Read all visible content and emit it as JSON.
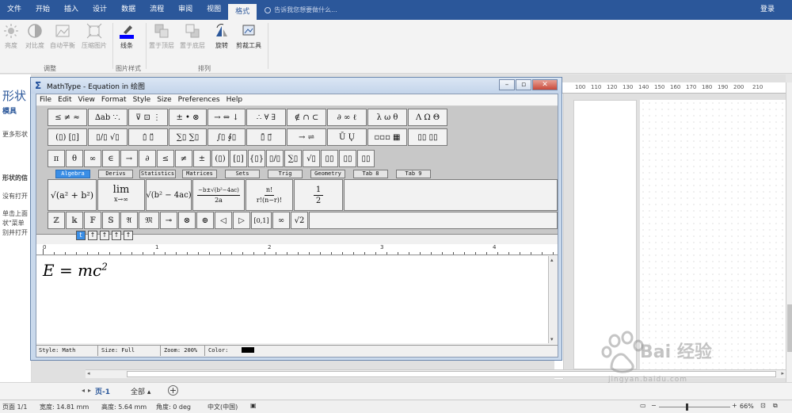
{
  "ribbon": {
    "tabs": [
      "文件",
      "开始",
      "插入",
      "设计",
      "数据",
      "流程",
      "审阅",
      "视图",
      "格式"
    ],
    "active_tab": "格式",
    "tell_me": "告诉我您想要做什么...",
    "login": "登录",
    "buttons": {
      "brightness": "亮度",
      "contrast": "对比度",
      "auto_balance": "自动平衡",
      "compress": "压缩图片",
      "line": "线条",
      "bring_forward": "置于顶层",
      "send_backward": "置于底层",
      "rotate": "旋转",
      "crop": "剪裁工具"
    },
    "groups": {
      "adjust": "调整",
      "picture_style": "图片样式",
      "arrange": "排列"
    }
  },
  "left_pane": {
    "title": "形状",
    "tab": "模具",
    "more": "更多形状",
    "section": "形状的信",
    "text1": "没有打开",
    "text2": "单击上面",
    "text3": "状\"菜单",
    "text4": "别并打开"
  },
  "ruler": {
    "labels": [
      "100",
      "110",
      "120",
      "130",
      "140",
      "150",
      "160",
      "170",
      "180",
      "190",
      "200",
      "210"
    ]
  },
  "mathtype": {
    "title": "MathType - Equation in 绘图",
    "menu": [
      "File",
      "Edit",
      "View",
      "Format",
      "Style",
      "Size",
      "Preferences",
      "Help"
    ],
    "palette_row1": [
      "≤ ≠ ≈",
      "∆ab ∵.",
      "⊽ ⊡ ⋮",
      "± • ⊗",
      "→ ⇔ ↓",
      "∴ ∀ ∃",
      "∉ ∩ ⊂",
      "∂ ∞ ℓ",
      "λ ω θ",
      "Λ Ω Θ"
    ],
    "palette_row2": [
      "(▯) [▯]",
      "▯/▯ √▯",
      "▯̇ ▯̈",
      "∑▯ ∑▯",
      "∫▯ ∮▯",
      "▯̄ ▯⃗",
      "→ ⇌",
      "Ū Ų",
      "▫▫▫ ▦",
      "▯▯ ▯▯"
    ],
    "symbol_row": [
      "π",
      "θ",
      "∞",
      "∈",
      "→",
      "∂",
      "≤",
      "≠",
      "±",
      "(▯)",
      "[▯]",
      "{▯}",
      "▯/▯",
      "∑▯",
      "√▯",
      "▯▯",
      "▯▯",
      "▯▯"
    ],
    "template_tabs": [
      "Algebra",
      "Derivs",
      "Statistics",
      "Matrices",
      "Sets",
      "Trig",
      "Geometry",
      "Tab 8",
      "Tab 9"
    ],
    "active_template_tab": "Algebra",
    "templates": {
      "pythag": "√(a² + b²)",
      "lim_top": "lim",
      "lim_bottom": "x→∞",
      "disc": "√(b² − 4ac)",
      "quad_num": "−b±√(b²−4ac)",
      "quad_den": "2a",
      "comb_num": "n!",
      "comb_den": "r!(n−r)!",
      "half_num": "1",
      "half_den": "2"
    },
    "template_row2": [
      "ℤ",
      "𝕜",
      "𝔽",
      "𝕊",
      "𝔄",
      "𝔐",
      "⊸",
      "⊗",
      "⊕",
      "◁",
      "▷",
      "[0,1]",
      "∞",
      "√2"
    ],
    "size_buttons": [
      "t",
      "↑",
      "↑",
      "↑",
      "↑"
    ],
    "ruler_labels": [
      "0",
      "1",
      "2",
      "3",
      "4"
    ],
    "formula_base": "E = mc",
    "formula_exp": "2",
    "status": {
      "style": "Style: Math",
      "size": "Size: Full",
      "zoom": "Zoom: 200%",
      "color": "Color:"
    }
  },
  "pages": {
    "current": "页-1",
    "all": "全部 ▴"
  },
  "statusbar": {
    "page": "页面 1/1",
    "width": "宽度: 14.81 mm",
    "height": "高度: 5.64 mm",
    "angle": "角度: 0 deg",
    "lang": "中文(中国)",
    "zoom": "66%"
  },
  "watermark": {
    "brand": "Bai 经验",
    "url": "jingyan.baidu.com"
  },
  "colors": {
    "ribbon_blue": "#2b579a",
    "selection_blue": "#3a8ee6",
    "dialog_frame": "#c9d9ec"
  }
}
